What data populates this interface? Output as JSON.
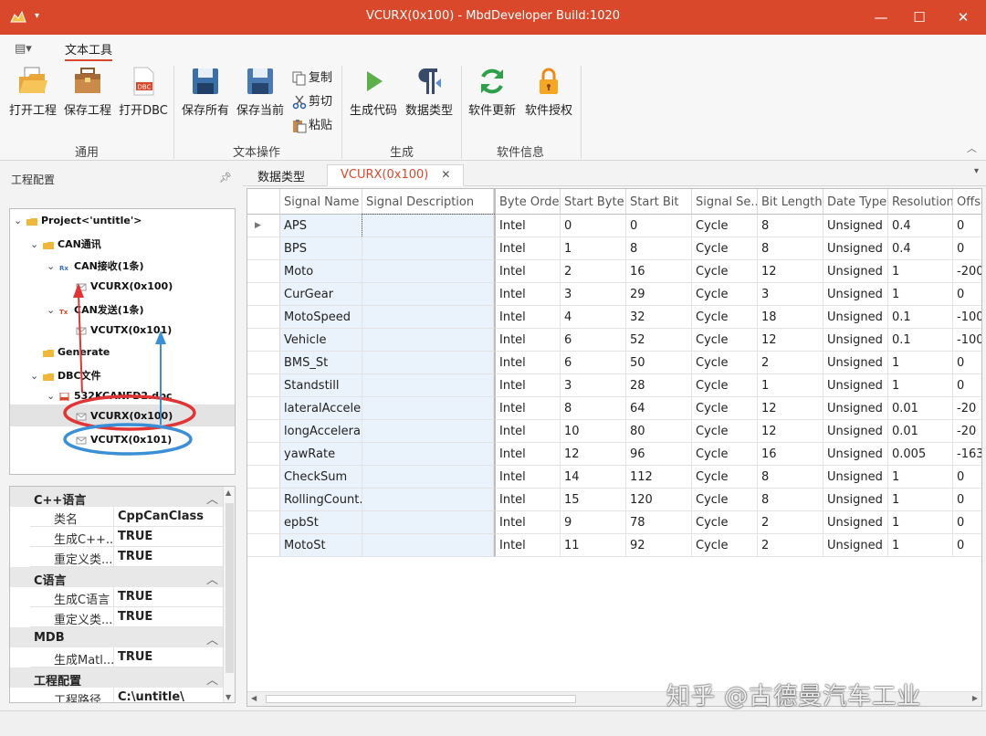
{
  "titlebar": {
    "title": "VCURX(0x100) - MbdDeveloper  Build:1020"
  },
  "ribbon": {
    "tab": "文本工具",
    "buttons": {
      "open_project": "打开工程",
      "save_project": "保存工程",
      "open_dbc": "打开DBC",
      "save_all": "保存所有",
      "save_current": "保存当前",
      "copy": "复制",
      "cut": "剪切",
      "paste": "粘贴",
      "gen_code": "生成代码",
      "data_type": "数据类型",
      "update": "软件更新",
      "license": "软件授权"
    },
    "groups": {
      "general": "通用",
      "text_ops": "文本操作",
      "generate": "生成",
      "info": "软件信息"
    }
  },
  "left": {
    "header": "工程配置",
    "tree": {
      "project": "Project<'untitle'>",
      "can": "CAN通讯",
      "can_rx": "CAN接收(1条)",
      "rx_msg": "VCURX(0x100)",
      "can_tx": "CAN发送(1条)",
      "tx_msg": "VCUTX(0x101)",
      "generate": "Generate",
      "dbc_folder": "DBC文件",
      "dbc_file": "532KCANFD2.dbc",
      "dbc_rx": "VCURX(0x100)",
      "dbc_tx": "VCUTX(0x101)"
    },
    "props": {
      "cpp": {
        "title": "C++语言",
        "rows": [
          [
            "类名",
            "CppCanClass"
          ],
          [
            "生成C++...",
            "TRUE"
          ],
          [
            "重定义类...",
            "TRUE"
          ]
        ]
      },
      "c": {
        "title": "C语言",
        "rows": [
          [
            "生成C语言",
            "TRUE"
          ],
          [
            "重定义类...",
            "TRUE"
          ]
        ]
      },
      "mdb": {
        "title": "MDB",
        "rows": [
          [
            "生成Matl...",
            "TRUE"
          ]
        ]
      },
      "project": {
        "title": "工程配置",
        "rows": [
          [
            "工程路径",
            "C:\\untitle\\"
          ]
        ]
      }
    }
  },
  "tabs": {
    "t1": "数据类型",
    "t2": "VCURX(0x100)"
  },
  "grid": {
    "columns": [
      "Signal Name",
      "Signal Description",
      "Byte Order",
      "Start Byte",
      "Start Bit",
      "Signal Se...",
      "Bit Length...",
      "Date Type",
      "Resolution",
      "Offse"
    ],
    "rows": [
      [
        "APS",
        "",
        "Intel",
        "0",
        "0",
        "Cycle",
        "8",
        "Unsigned",
        "0.4",
        "0"
      ],
      [
        "BPS",
        "",
        "Intel",
        "1",
        "8",
        "Cycle",
        "8",
        "Unsigned",
        "0.4",
        "0"
      ],
      [
        "Moto",
        "",
        "Intel",
        "2",
        "16",
        "Cycle",
        "12",
        "Unsigned",
        "1",
        "-200"
      ],
      [
        "CurGear",
        "",
        "Intel",
        "3",
        "29",
        "Cycle",
        "3",
        "Unsigned",
        "1",
        "0"
      ],
      [
        "MotoSpeed",
        "",
        "Intel",
        "4",
        "32",
        "Cycle",
        "18",
        "Unsigned",
        "0.1",
        "-100"
      ],
      [
        "Vehicle",
        "",
        "Intel",
        "6",
        "52",
        "Cycle",
        "12",
        "Unsigned",
        "0.1",
        "-100"
      ],
      [
        "BMS_St",
        "",
        "Intel",
        "6",
        "50",
        "Cycle",
        "2",
        "Unsigned",
        "1",
        "0"
      ],
      [
        "Standstill",
        "",
        "Intel",
        "3",
        "28",
        "Cycle",
        "1",
        "Unsigned",
        "1",
        "0"
      ],
      [
        "lateralAccele...",
        "",
        "Intel",
        "8",
        "64",
        "Cycle",
        "12",
        "Unsigned",
        "0.01",
        "-20"
      ],
      [
        "longAccelera...",
        "",
        "Intel",
        "10",
        "80",
        "Cycle",
        "12",
        "Unsigned",
        "0.01",
        "-20"
      ],
      [
        "yawRate",
        "",
        "Intel",
        "12",
        "96",
        "Cycle",
        "16",
        "Unsigned",
        "0.005",
        "-163"
      ],
      [
        "CheckSum",
        "",
        "Intel",
        "14",
        "112",
        "Cycle",
        "8",
        "Unsigned",
        "1",
        "0"
      ],
      [
        "RollingCount...",
        "",
        "Intel",
        "15",
        "120",
        "Cycle",
        "8",
        "Unsigned",
        "1",
        "0"
      ],
      [
        "epbSt",
        "",
        "Intel",
        "9",
        "78",
        "Cycle",
        "2",
        "Unsigned",
        "1",
        "0"
      ],
      [
        "MotoSt",
        "",
        "Intel",
        "11",
        "92",
        "Cycle",
        "2",
        "Unsigned",
        "1",
        "0"
      ]
    ]
  },
  "watermark": "知乎 @古德曼汽车工业",
  "colors": {
    "accent": "#d9482b",
    "annotation_red": "#e03535",
    "annotation_blue": "#3a8fd6"
  }
}
